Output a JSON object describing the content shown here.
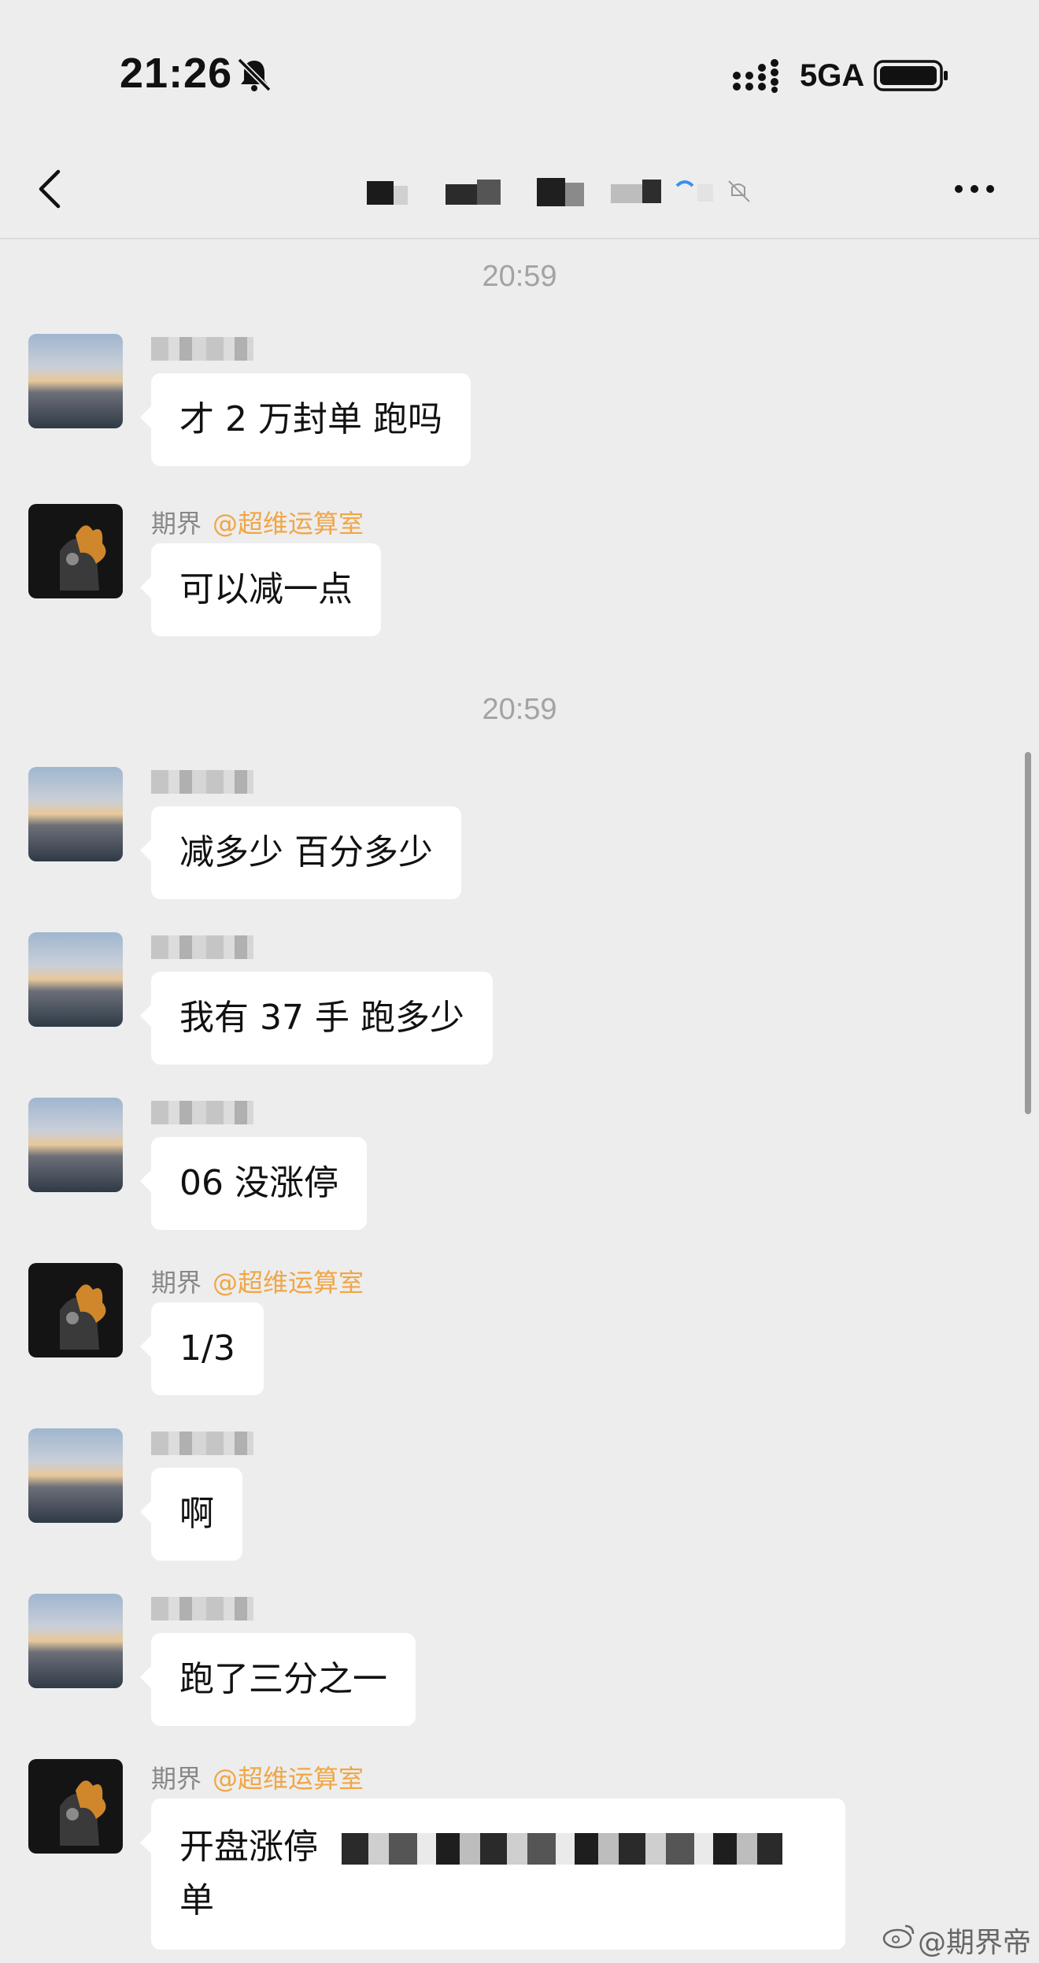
{
  "status_bar": {
    "time": "21:26",
    "network": "5GA",
    "icons": [
      "bell-slash-icon",
      "signal-bars-icon",
      "battery-icon"
    ]
  },
  "nav": {
    "back_icon": "chevron-left-icon",
    "more_icon": "ellipsis-icon"
  },
  "chat": {
    "timestamps": [
      "20:59",
      "20:59"
    ],
    "messages": [
      {
        "sender": "",
        "mention": "",
        "text": "才 2 万封单  跑吗"
      },
      {
        "sender": "期界",
        "mention": "@超维运算室",
        "text": "可以减一点"
      },
      {
        "sender": "",
        "mention": "",
        "text": "减多少 百分多少"
      },
      {
        "sender": "",
        "mention": "",
        "text": "我有 37 手 跑多少"
      },
      {
        "sender": "",
        "mention": "",
        "text": "06 没涨停"
      },
      {
        "sender": "期界",
        "mention": "@超维运算室",
        "text": "1/3"
      },
      {
        "sender": "",
        "mention": "",
        "text": "啊"
      },
      {
        "sender": "",
        "mention": "",
        "text": "跑了三分之一"
      },
      {
        "sender": "期界",
        "mention": "@超维运算室",
        "text": "开盘涨停",
        "text_tail": "单"
      }
    ]
  },
  "watermark": "@期界帝",
  "colors": {
    "background": "#ededed",
    "bubble": "#ffffff",
    "mention": "#f0a646",
    "timestamp": "#a3a3a3"
  }
}
